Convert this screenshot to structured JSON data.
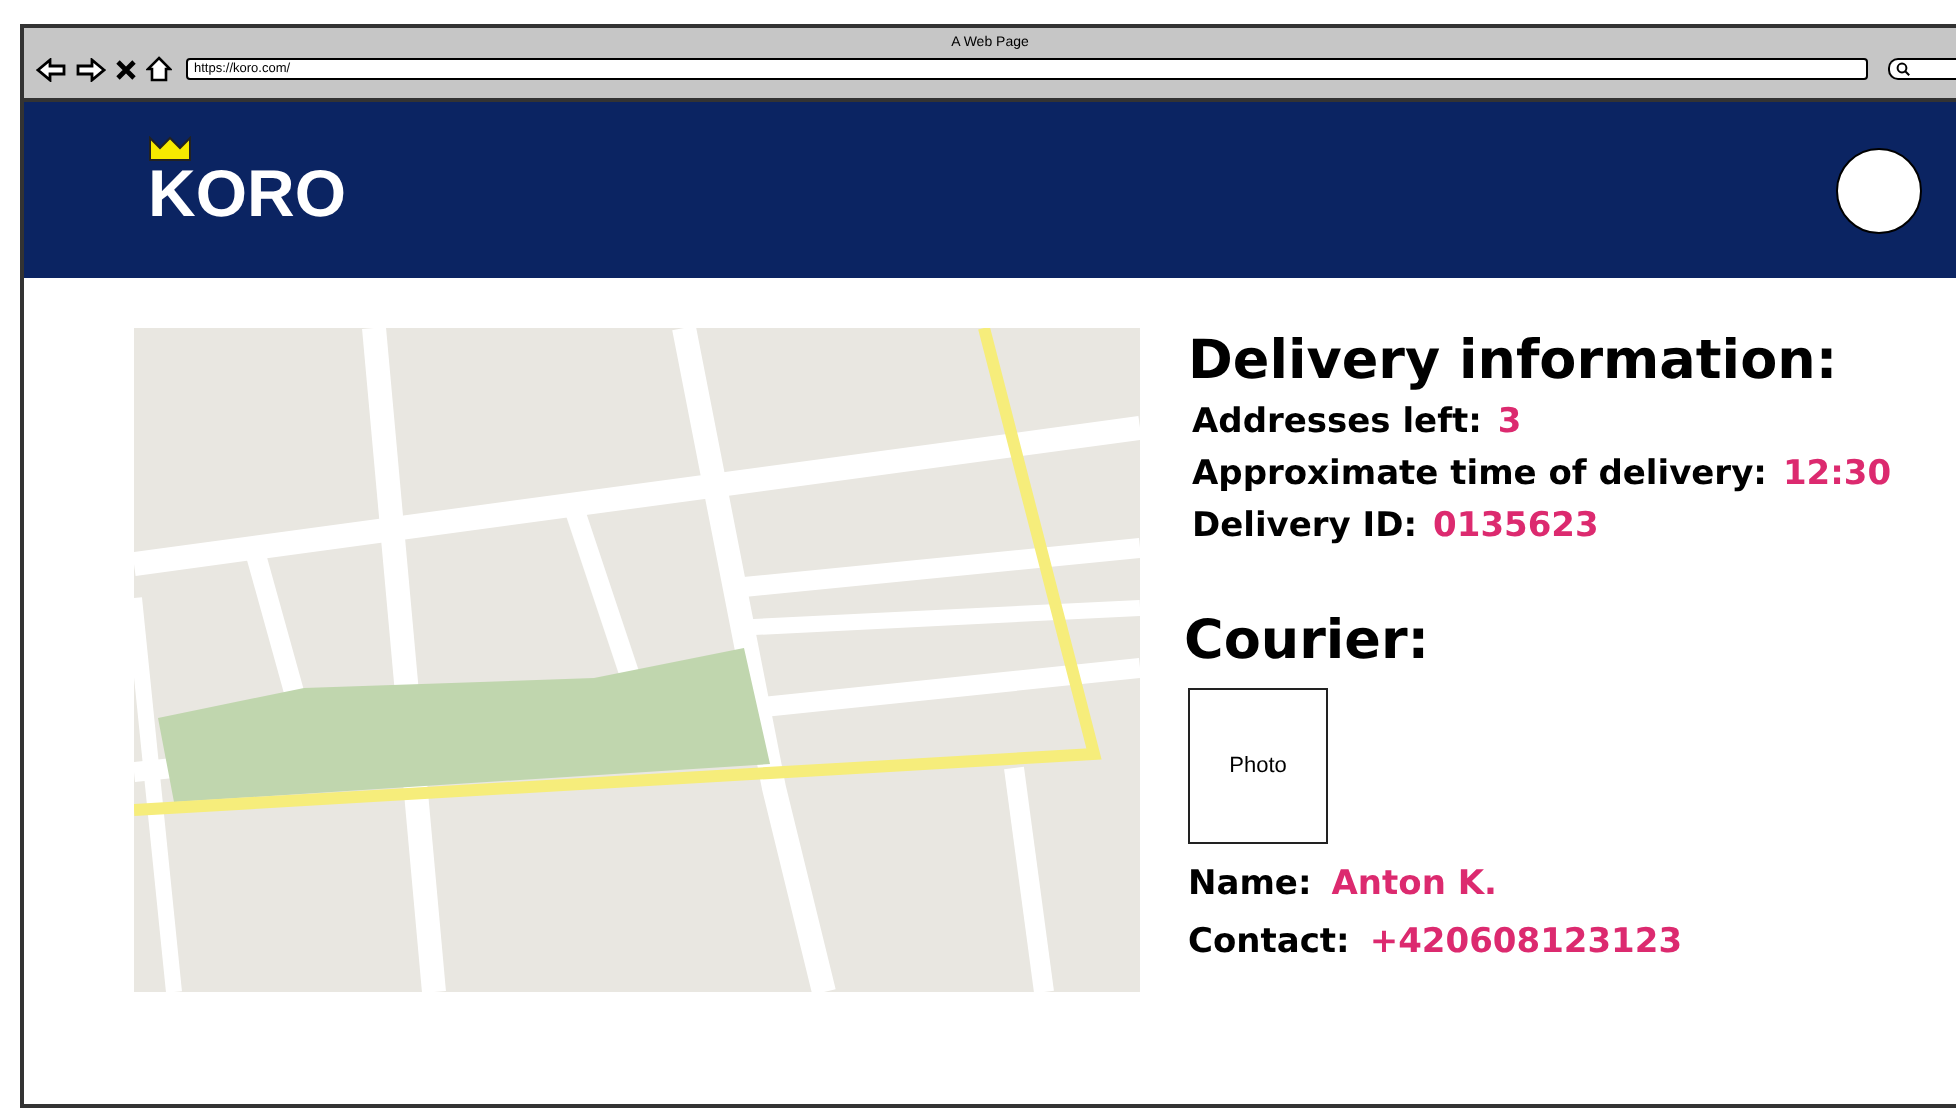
{
  "window": {
    "title": "A Web Page"
  },
  "browser": {
    "url": "https://koro.com/"
  },
  "header": {
    "logo": "KORO"
  },
  "delivery": {
    "heading": "Delivery information:",
    "fields": [
      {
        "label": "Addresses left:",
        "value": "3"
      },
      {
        "label": "Approximate time of delivery:",
        "value": "12:30"
      },
      {
        "label": "Delivery ID:",
        "value": "0135623"
      }
    ]
  },
  "courier": {
    "heading": "Courier:",
    "photo": "Photo",
    "fields": [
      {
        "label": "Name:",
        "value": "Anton K."
      },
      {
        "label": "Contact:",
        "value": "+420608123123"
      }
    ]
  }
}
